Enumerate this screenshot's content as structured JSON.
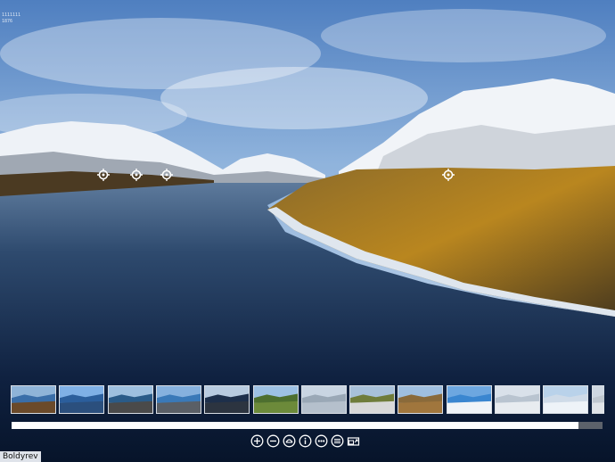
{
  "overlay": {
    "corner_lines": [
      "1111111",
      "1876"
    ]
  },
  "hotspots": [
    {
      "name": "hotspot-1",
      "icon": "target-icon"
    },
    {
      "name": "hotspot-2",
      "icon": "target-icon"
    },
    {
      "name": "hotspot-3",
      "icon": "target-icon"
    },
    {
      "name": "hotspot-4",
      "icon": "target-icon"
    }
  ],
  "thumbnails": [
    {
      "sky": "#8fb4d8",
      "ground": "#6b4a2a",
      "water": "#3a6ea8"
    },
    {
      "sky": "#7fb0e6",
      "ground": "#2b4f7d",
      "water": "#2b5e9c"
    },
    {
      "sky": "#9ec0df",
      "ground": "#4a4a4a",
      "water": "#2a5b88"
    },
    {
      "sky": "#86b1de",
      "ground": "#5a5f66",
      "water": "#3a79b8"
    },
    {
      "sky": "#b8cbe0",
      "ground": "#2c3440",
      "water": "#1d2f4b"
    },
    {
      "sky": "#9dc1e4",
      "ground": "#6c8a3a",
      "water": "#4d6f2f"
    },
    {
      "sky": "#c9d5e2",
      "ground": "#b5c0cc",
      "water": "#9aa8b6"
    },
    {
      "sky": "#a8c1da",
      "ground": "#d8d8d8",
      "water": "#6f7c3a"
    },
    {
      "sky": "#9fbfe0",
      "ground": "#a0763d",
      "water": "#8a6a3a"
    },
    {
      "sky": "#6da7e0",
      "ground": "#f0f4f8",
      "water": "#3a86d0"
    },
    {
      "sky": "#d9e1ea",
      "ground": "#e8ecf0",
      "water": "#b9c4d0"
    },
    {
      "sky": "#b9d2ea",
      "ground": "#eef3f8",
      "water": "#cfdbe8"
    },
    {
      "sky": "#cfd8e2",
      "ground": "#e0e4e8",
      "water": "#c0c8d0"
    }
  ],
  "progress": {
    "value": 0.96
  },
  "controls": [
    {
      "name": "zoom-in-button",
      "icon": "zoom-in-icon"
    },
    {
      "name": "zoom-out-button",
      "icon": "zoom-out-icon"
    },
    {
      "name": "vr-button",
      "icon": "vr-icon"
    },
    {
      "name": "info-button",
      "icon": "info-icon"
    },
    {
      "name": "hotspots-toggle-button",
      "icon": "dots-icon"
    },
    {
      "name": "thumbnails-toggle-button",
      "icon": "list-icon"
    },
    {
      "name": "fullscreen-button",
      "icon": "fullscreen-icon"
    }
  ],
  "author": "Boldyrev",
  "colors": {
    "accent": "#ffffff",
    "bar_bg": "#5c626b"
  }
}
